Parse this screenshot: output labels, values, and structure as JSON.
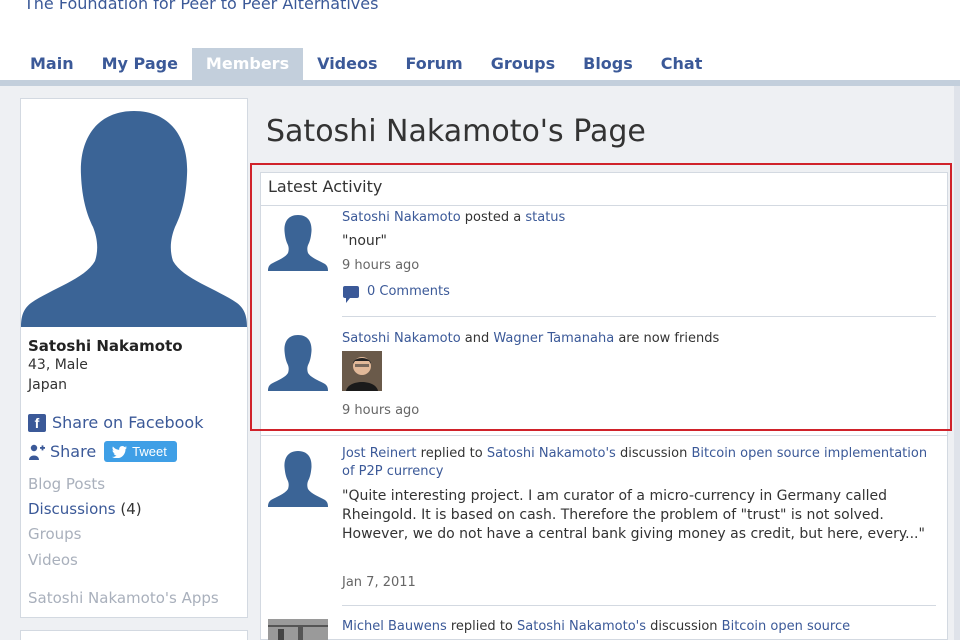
{
  "site": {
    "title": "The Foundation for Peer to Peer Alternatives"
  },
  "nav": {
    "tabs": [
      {
        "label": "Main",
        "active": false
      },
      {
        "label": "My Page",
        "active": false
      },
      {
        "label": "Members",
        "active": true
      },
      {
        "label": "Videos",
        "active": false
      },
      {
        "label": "Forum",
        "active": false
      },
      {
        "label": "Groups",
        "active": false
      },
      {
        "label": "Blogs",
        "active": false
      },
      {
        "label": "Chat",
        "active": false
      }
    ]
  },
  "profile": {
    "name": "Satoshi Nakamoto",
    "age_gender": "43, Male",
    "country": "Japan",
    "share_facebook": "Share on Facebook",
    "share": "Share",
    "tweet": "Tweet",
    "links": [
      {
        "label": "Blog Posts",
        "count": "",
        "muted": true
      },
      {
        "label": "Discussions",
        "count": "(4)",
        "muted": false
      },
      {
        "label": "Groups",
        "count": "",
        "muted": true
      },
      {
        "label": "Videos",
        "count": "",
        "muted": true
      }
    ],
    "apps": "Satoshi Nakamoto's Apps"
  },
  "page": {
    "title": "Satoshi Nakamoto's Page"
  },
  "activity": {
    "header": "Latest Activity",
    "items": [
      {
        "actor": "Satoshi Nakamoto",
        "verb": "posted a",
        "object": "status",
        "quote": "\"nour\"",
        "time": "9 hours ago",
        "comments": "0 Comments"
      },
      {
        "actor": "Satoshi Nakamoto",
        "verb": "and",
        "actor2": "Wagner Tamanaha",
        "verb2": "are now friends",
        "time": "9 hours ago"
      },
      {
        "actor": "Jost Reinert",
        "verb": "replied",
        "to": "to",
        "owner": "Satoshi Nakamoto's",
        "kind": "discussion",
        "discussion": "Bitcoin open source implementation of P2P currency",
        "quote": "\"Quite interesting project. I am curator of a micro-currency in Germany called Rheingold. It is based on cash. Therefore the problem of \"trust\" is not solved. However, we do not have a central bank giving money as credit, but here, every...\"",
        "time": "Jan 7, 2011"
      },
      {
        "actor": "Michel Bauwens",
        "verb": "replied",
        "to": "to",
        "owner": "Satoshi Nakamoto's",
        "kind": "discussion",
        "discussion": "Bitcoin open source"
      }
    ]
  },
  "colors": {
    "link": "#3b5998",
    "highlight": "#d0222a",
    "tab_active": "#c3cfdc"
  }
}
